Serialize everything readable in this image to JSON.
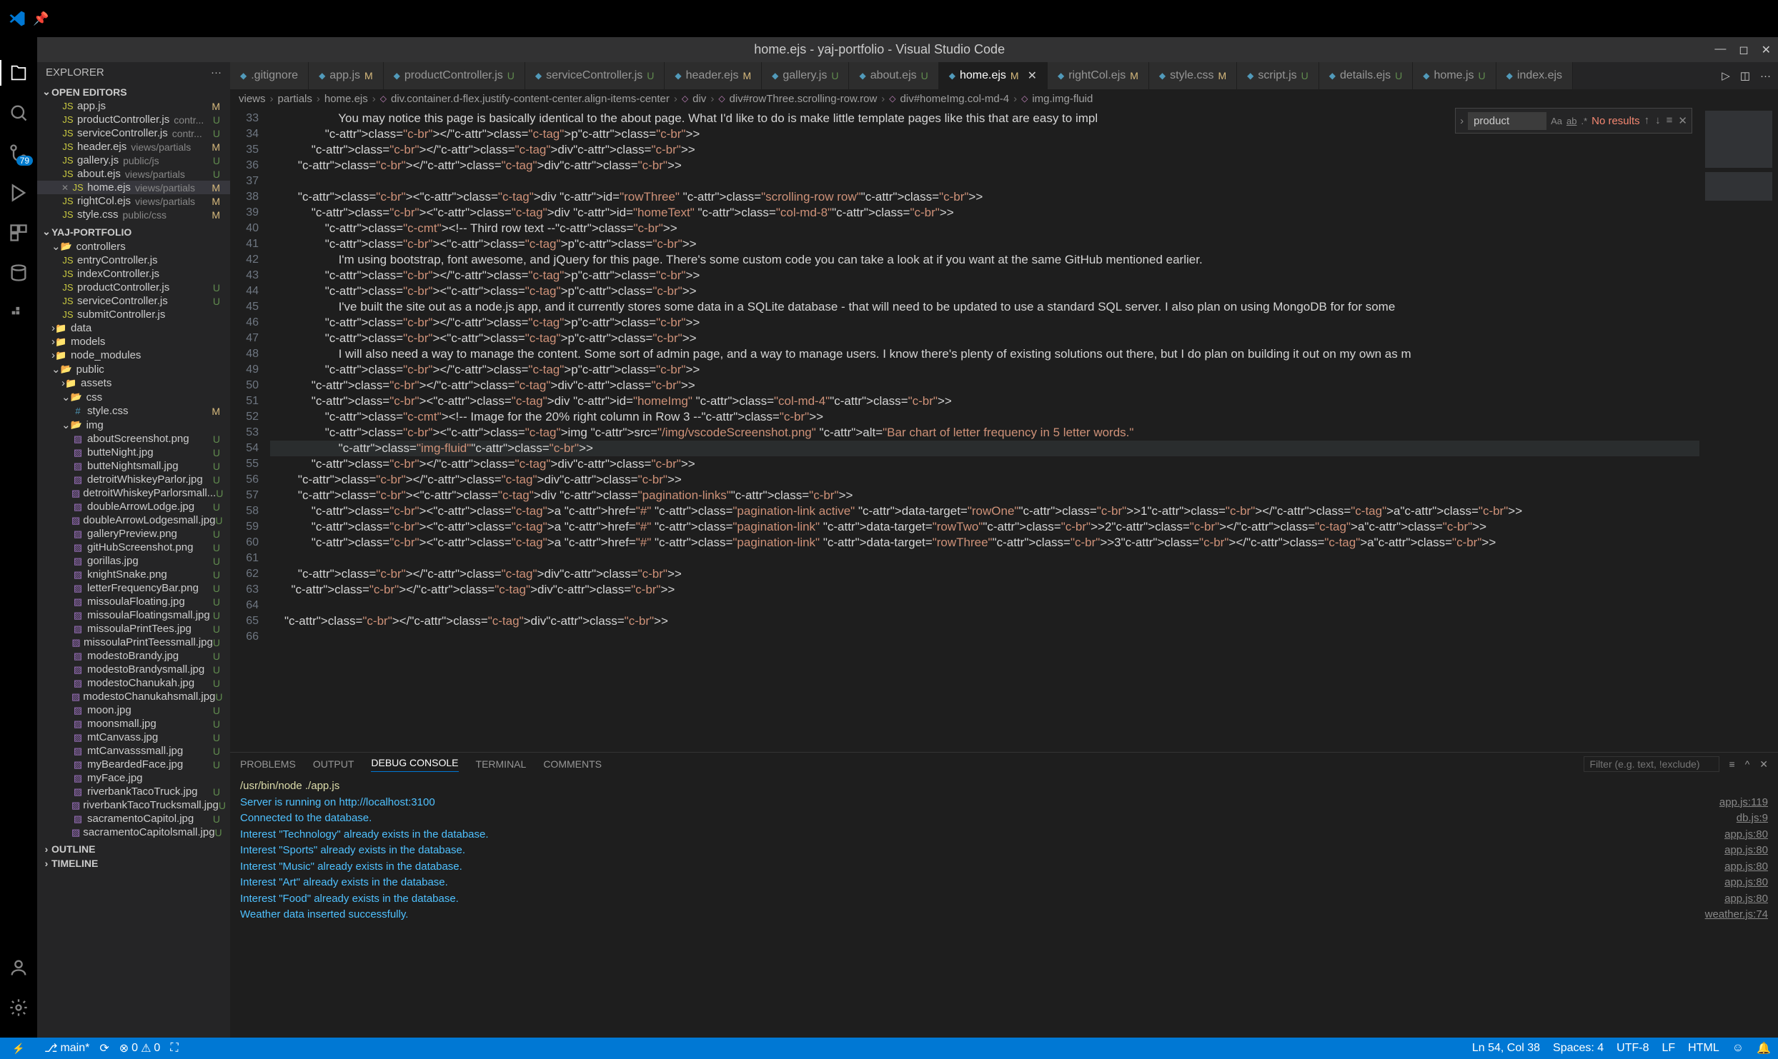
{
  "window": {
    "title": "home.ejs - yaj-portfolio - Visual Studio Code"
  },
  "activity_bar": {
    "badge_scm": "79"
  },
  "sidebar": {
    "title": "EXPLORER",
    "sections": {
      "open_editors": "OPEN EDITORS",
      "project": "YAJ-PORTFOLIO",
      "outline": "OUTLINE",
      "timeline": "TIMELINE"
    },
    "open_editors_items": [
      {
        "name": "app.js",
        "status": "M"
      },
      {
        "name": "productController.js",
        "sub": "contr...",
        "status": "U"
      },
      {
        "name": "serviceController.js",
        "sub": "contr...",
        "status": "U"
      },
      {
        "name": "header.ejs",
        "sub": "views/partials",
        "status": "M"
      },
      {
        "name": "gallery.js",
        "sub": "public/js",
        "status": "U"
      },
      {
        "name": "about.ejs",
        "sub": "views/partials",
        "status": "U"
      },
      {
        "name": "home.ejs",
        "sub": "views/partials",
        "status": "M",
        "active": true
      },
      {
        "name": "rightCol.ejs",
        "sub": "views/partials",
        "status": "M"
      },
      {
        "name": "style.css",
        "sub": "public/css",
        "status": "M"
      }
    ],
    "tree": {
      "controllers": "controllers",
      "controllers_items": [
        {
          "name": "entryController.js"
        },
        {
          "name": "indexController.js"
        },
        {
          "name": "productController.js",
          "status": "U"
        },
        {
          "name": "serviceController.js",
          "status": "U"
        },
        {
          "name": "submitController.js"
        }
      ],
      "data": "data",
      "models": "models",
      "node_modules": "node_modules",
      "public": "public",
      "assets": "assets",
      "css": "css",
      "style_css": {
        "name": "style.css",
        "status": "M"
      },
      "img": "img",
      "img_items": [
        {
          "name": "aboutScreenshot.png",
          "status": "U"
        },
        {
          "name": "butteNight.jpg",
          "status": "U"
        },
        {
          "name": "butteNightsmall.jpg",
          "status": "U"
        },
        {
          "name": "detroitWhiskeyParlor.jpg",
          "status": "U"
        },
        {
          "name": "detroitWhiskeyParlorsmall...",
          "status": "U"
        },
        {
          "name": "doubleArrowLodge.jpg",
          "status": "U"
        },
        {
          "name": "doubleArrowLodgesmall.jpg",
          "status": "U"
        },
        {
          "name": "galleryPreview.png",
          "status": "U"
        },
        {
          "name": "gitHubScreenshot.png",
          "status": "U"
        },
        {
          "name": "gorillas.jpg",
          "status": "U"
        },
        {
          "name": "knightSnake.png",
          "status": "U"
        },
        {
          "name": "letterFrequencyBar.png",
          "status": "U"
        },
        {
          "name": "missoulaFloating.jpg",
          "status": "U"
        },
        {
          "name": "missoulaFloatingsmall.jpg",
          "status": "U"
        },
        {
          "name": "missoulaPrintTees.jpg",
          "status": "U"
        },
        {
          "name": "missoulaPrintTeessmall.jpg",
          "status": "U"
        },
        {
          "name": "modestoBrandy.jpg",
          "status": "U"
        },
        {
          "name": "modestoBrandysmall.jpg",
          "status": "U"
        },
        {
          "name": "modestoChanukah.jpg",
          "status": "U"
        },
        {
          "name": "modestoChanukahsmall.jpg",
          "status": "U"
        },
        {
          "name": "moon.jpg",
          "status": "U"
        },
        {
          "name": "moonsmall.jpg",
          "status": "U"
        },
        {
          "name": "mtCanvass.jpg",
          "status": "U"
        },
        {
          "name": "mtCanvasssmall.jpg",
          "status": "U"
        },
        {
          "name": "myBeardedFace.jpg",
          "status": "U"
        },
        {
          "name": "myFace.jpg"
        },
        {
          "name": "riverbankTacoTruck.jpg",
          "status": "U"
        },
        {
          "name": "riverbankTacoTrucksmall.jpg",
          "status": "U"
        },
        {
          "name": "sacramentoCapitol.jpg",
          "status": "U"
        },
        {
          "name": "sacramentoCapitolsmall.jpg",
          "status": "U"
        }
      ]
    }
  },
  "tabs": [
    {
      "name": ".gitignore"
    },
    {
      "name": "app.js",
      "badge": "M"
    },
    {
      "name": "productController.js",
      "badge": "U"
    },
    {
      "name": "serviceController.js",
      "badge": "U"
    },
    {
      "name": "header.ejs",
      "badge": "M"
    },
    {
      "name": "gallery.js",
      "badge": "U"
    },
    {
      "name": "about.ejs",
      "badge": "U"
    },
    {
      "name": "home.ejs",
      "badge": "M",
      "active": true
    },
    {
      "name": "rightCol.ejs",
      "badge": "M"
    },
    {
      "name": "style.css",
      "badge": "M"
    },
    {
      "name": "script.js",
      "badge": "U"
    },
    {
      "name": "details.ejs",
      "badge": "U"
    },
    {
      "name": "home.js",
      "badge": "U"
    },
    {
      "name": "index.ejs"
    }
  ],
  "breadcrumbs": [
    "views",
    "partials",
    "home.ejs",
    "div.container.d-flex.justify-content-center.align-items-center",
    "div",
    "div#rowThree.scrolling-row.row",
    "div#homeImg.col-md-4",
    "img.img-fluid"
  ],
  "editor": {
    "line_start": 33,
    "lines": [
      "                You may notice this page is basically identical to the about page. What I'd like to do is make little template pages like this that are easy to impl",
      "            </p>",
      "        </div>",
      "    </div>",
      "",
      "    <div id=\"rowThree\" class=\"scrolling-row row\">",
      "        <div id=\"homeText\" class=\"col-md-8\">",
      "            <!-- Third row text -->",
      "            <p>",
      "                I'm using bootstrap, font awesome, and jQuery for this page. There's some custom code you can take a look at if you want at the same GitHub mentioned earlier.",
      "            </p>",
      "            <p>",
      "                I've built the site out as a node.js app, and it currently stores some data in a SQLite database - that will need to be updated to use a standard SQL server. I also plan on using MongoDB for for some ",
      "            </p>",
      "            <p>",
      "                I will also need a way to manage the content. Some sort of admin page, and a way to manage users. I know there's plenty of existing solutions out there, but I do plan on building it out on my own as m",
      "            </p>",
      "        </div>",
      "        <div id=\"homeImg\" class=\"col-md-4\">",
      "            <!-- Image for the 20% right column in Row 3 -->",
      "            <img src=\"/img/vscodeScreenshot.png\" alt=\"Bar chart of letter frequency in 5 letter words.\"",
      "                class=\"img-fluid\">",
      "        </div>",
      "    </div>",
      "    <div class=\"pagination-links\">",
      "        <a href=\"#\" class=\"pagination-link active\" data-target=\"rowOne\">1</a>",
      "        <a href=\"#\" class=\"pagination-link\" data-target=\"rowTwo\">2</a>",
      "        <a href=\"#\" class=\"pagination-link\" data-target=\"rowThree\">3</a>",
      "",
      "    </div>",
      "  </div>",
      "",
      "</div>",
      ""
    ]
  },
  "find": {
    "value": "product",
    "results": "No results"
  },
  "panel": {
    "tabs": [
      "PROBLEMS",
      "OUTPUT",
      "DEBUG CONSOLE",
      "TERMINAL",
      "COMMENTS"
    ],
    "filter_placeholder": "Filter (e.g. text, !exclude)",
    "lines": [
      {
        "msg": "/usr/bin/node ./app.js",
        "src": "",
        "yellow": true
      },
      {
        "msg": "Server is running on http://localhost:3100",
        "src": "app.js:119"
      },
      {
        "msg": "Connected to the database.",
        "src": "db.js:9"
      },
      {
        "msg": "Interest \"Technology\" already exists in the database.",
        "src": "app.js:80"
      },
      {
        "msg": "Interest \"Sports\" already exists in the database.",
        "src": "app.js:80"
      },
      {
        "msg": "Interest \"Music\" already exists in the database.",
        "src": "app.js:80"
      },
      {
        "msg": "Interest \"Art\" already exists in the database.",
        "src": "app.js:80"
      },
      {
        "msg": "Interest \"Food\" already exists in the database.",
        "src": "app.js:80"
      },
      {
        "msg": "Weather data inserted successfully.",
        "src": "weather.js:74"
      }
    ]
  },
  "statusbar": {
    "branch": "main*",
    "sync": "⟳",
    "errors": "0",
    "warnings": "0",
    "port": "⛶",
    "ln_col": "Ln 54, Col 38",
    "spaces": "Spaces: 4",
    "encoding": "UTF-8",
    "eol": "LF",
    "lang": "HTML"
  }
}
